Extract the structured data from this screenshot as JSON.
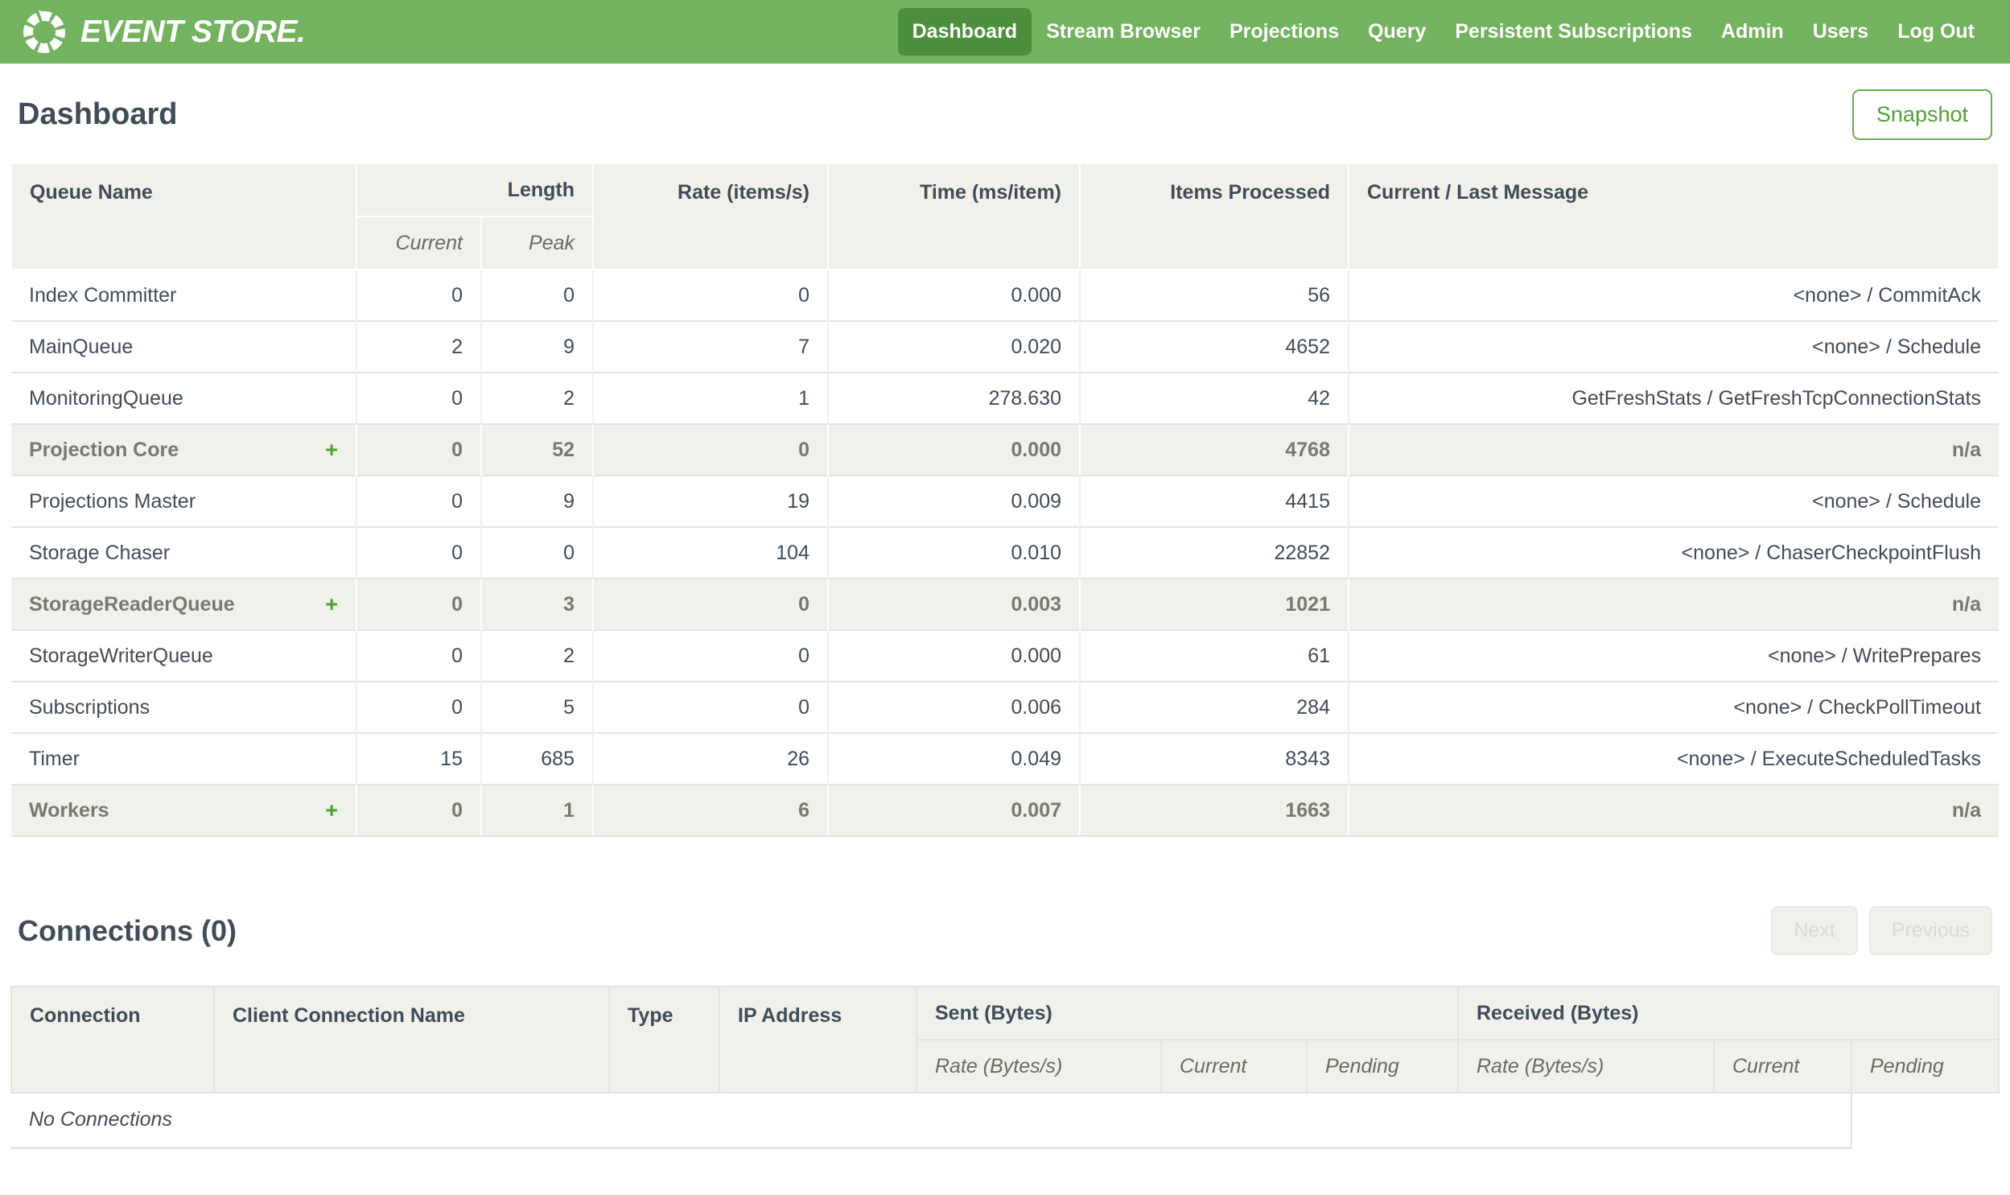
{
  "colors": {
    "nav_bg": "#73b25e",
    "nav_active_bg": "#4d8f3c",
    "accent_green": "#4da12f",
    "header_bg": "#f0f1ea",
    "text_dark": "#3f4c59",
    "text_gray": "#757b6e",
    "border_light": "#e4e6dd",
    "disabled_text": "#d8dbce",
    "button_green": "#51a135"
  },
  "nav": {
    "brand": "EVENT STORE.",
    "items": [
      {
        "label": "Dashboard",
        "active": true
      },
      {
        "label": "Stream Browser",
        "active": false
      },
      {
        "label": "Projections",
        "active": false
      },
      {
        "label": "Query",
        "active": false
      },
      {
        "label": "Persistent Subscriptions",
        "active": false
      },
      {
        "label": "Admin",
        "active": false
      },
      {
        "label": "Users",
        "active": false
      },
      {
        "label": "Log Out",
        "active": false
      }
    ]
  },
  "page": {
    "title": "Dashboard",
    "snapshot_button": "Snapshot"
  },
  "queue_table": {
    "headers": {
      "queue_name": "Queue Name",
      "length": "Length",
      "current": "Current",
      "peak": "Peak",
      "rate": "Rate (items/s)",
      "time": "Time (ms/item)",
      "items_processed": "Items Processed",
      "message": "Current / Last Message"
    },
    "rows": [
      {
        "name": "Index Committer",
        "group": false,
        "expand": "",
        "current": "0",
        "peak": "0",
        "rate": "0",
        "time": "0.000",
        "items": "56",
        "message": "<none> / CommitAck"
      },
      {
        "name": "MainQueue",
        "group": false,
        "expand": "",
        "current": "2",
        "peak": "9",
        "rate": "7",
        "time": "0.020",
        "items": "4652",
        "message": "<none> / Schedule"
      },
      {
        "name": "MonitoringQueue",
        "group": false,
        "expand": "",
        "current": "0",
        "peak": "2",
        "rate": "1",
        "time": "278.630",
        "items": "42",
        "message": "GetFreshStats / GetFreshTcpConnectionStats"
      },
      {
        "name": "Projection Core",
        "group": true,
        "expand": "+",
        "current": "0",
        "peak": "52",
        "rate": "0",
        "time": "0.000",
        "items": "4768",
        "message": "n/a"
      },
      {
        "name": "Projections Master",
        "group": false,
        "expand": "",
        "current": "0",
        "peak": "9",
        "rate": "19",
        "time": "0.009",
        "items": "4415",
        "message": "<none> / Schedule"
      },
      {
        "name": "Storage Chaser",
        "group": false,
        "expand": "",
        "current": "0",
        "peak": "0",
        "rate": "104",
        "time": "0.010",
        "items": "22852",
        "message": "<none> / ChaserCheckpointFlush"
      },
      {
        "name": "StorageReaderQueue",
        "group": true,
        "expand": "+",
        "current": "0",
        "peak": "3",
        "rate": "0",
        "time": "0.003",
        "items": "1021",
        "message": "n/a"
      },
      {
        "name": "StorageWriterQueue",
        "group": false,
        "expand": "",
        "current": "0",
        "peak": "2",
        "rate": "0",
        "time": "0.000",
        "items": "61",
        "message": "<none> / WritePrepares"
      },
      {
        "name": "Subscriptions",
        "group": false,
        "expand": "",
        "current": "0",
        "peak": "5",
        "rate": "0",
        "time": "0.006",
        "items": "284",
        "message": "<none> / CheckPollTimeout"
      },
      {
        "name": "Timer",
        "group": false,
        "expand": "",
        "current": "15",
        "peak": "685",
        "rate": "26",
        "time": "0.049",
        "items": "8343",
        "message": "<none> / ExecuteScheduledTasks"
      },
      {
        "name": "Workers",
        "group": true,
        "expand": "+",
        "current": "0",
        "peak": "1",
        "rate": "6",
        "time": "0.007",
        "items": "1663",
        "message": "n/a"
      }
    ]
  },
  "connections": {
    "title": "Connections (0)",
    "next_button": "Next",
    "previous_button": "Previous",
    "headers": {
      "connection": "Connection",
      "client_connection_name": "Client Connection Name",
      "type": "Type",
      "ip_address": "IP Address",
      "sent": "Sent (Bytes)",
      "received": "Received (Bytes)",
      "rate": "Rate (Bytes/s)",
      "current": "Current",
      "pending": "Pending"
    },
    "empty_text": "No Connections"
  }
}
